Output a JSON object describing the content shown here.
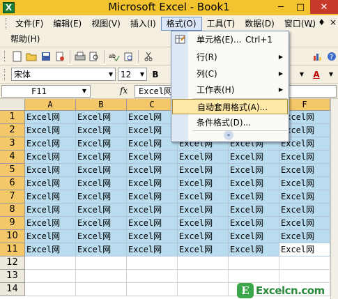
{
  "window": {
    "title": "Microsoft Excel - Book1",
    "minimize": "─",
    "maximize": "□",
    "close": "✕"
  },
  "menubar": {
    "row1": [
      "文件(F)",
      "编辑(E)",
      "视图(V)",
      "插入(I)",
      "格式(O)",
      "工具(T)",
      "数据(D)",
      "窗口(W)"
    ],
    "row2": [
      "帮助(H)"
    ],
    "active_index": 4,
    "mdi": [
      "_",
      "♦",
      "×"
    ]
  },
  "toolbar": {
    "font_name": "宋体",
    "font_size": "12",
    "bold": "B",
    "font_color_glyph": "A"
  },
  "formula_bar": {
    "name_box": "F11",
    "fx": "fx",
    "content": "Excel网"
  },
  "grid": {
    "columns": [
      "A",
      "B",
      "C",
      "D",
      "E",
      "F"
    ],
    "rows": [
      "1",
      "2",
      "3",
      "4",
      "5",
      "6",
      "7",
      "8",
      "9",
      "10",
      "11",
      "12",
      "13",
      "14"
    ],
    "cell_text": "Excel网",
    "data_row_count": 11
  },
  "format_menu": {
    "items": [
      {
        "label": "单元格(E)...",
        "shortcut": "Ctrl+1",
        "submenu": false
      },
      {
        "label": "行(R)",
        "shortcut": "",
        "submenu": true
      },
      {
        "label": "列(C)",
        "shortcut": "",
        "submenu": true
      },
      {
        "label": "工作表(H)",
        "shortcut": "",
        "submenu": true
      },
      {
        "label": "自动套用格式(A)...",
        "shortcut": "",
        "submenu": false
      },
      {
        "label": "条件格式(D)...",
        "shortcut": "",
        "submenu": false
      }
    ],
    "highlighted_index": 4,
    "expand_glyph": "»"
  },
  "watermark": {
    "logo": "E",
    "text": "Excelcn.com"
  }
}
